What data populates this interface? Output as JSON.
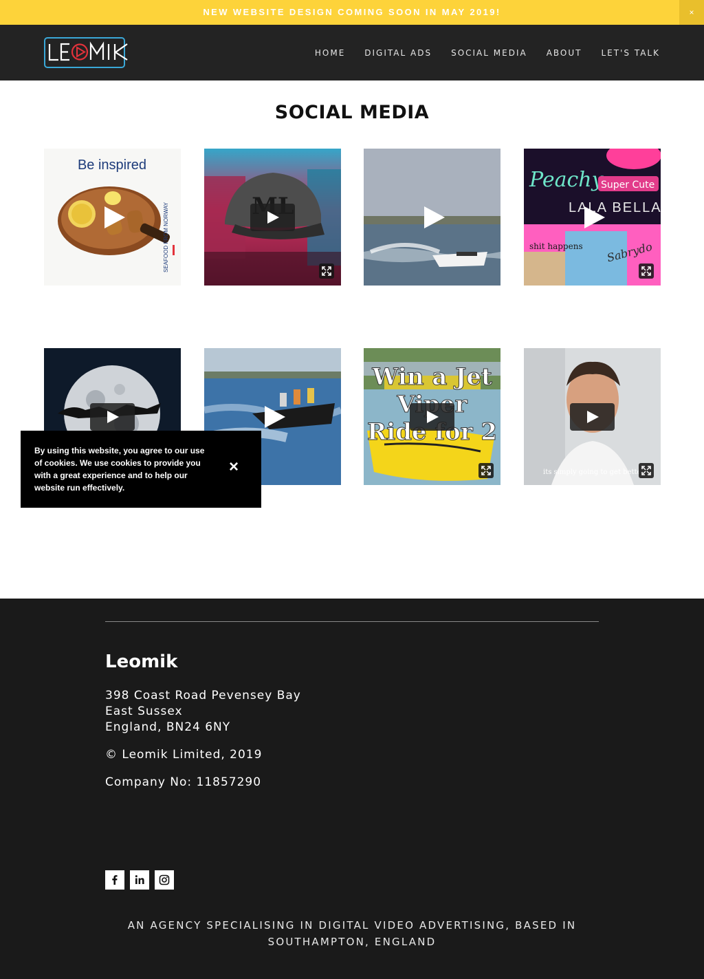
{
  "announcement": {
    "text": "NEW WEBSITE DESIGN COMING SOON IN MAY 2019!",
    "close_label": "×"
  },
  "header": {
    "logo_text": "LEOMIK",
    "nav": [
      "HOME",
      "DIGITAL ADS",
      "SOCIAL MEDIA",
      "ABOUT",
      "LET'S TALK"
    ]
  },
  "main": {
    "title": "SOCIAL MEDIA",
    "tiles": [
      {
        "caption": "Be inspired",
        "brand": "SEAFOOD FROM NORWAY"
      },
      {
        "caption": "ML"
      },
      {
        "caption": ""
      },
      {
        "caption": "Peachy",
        "caption2": "Super Cute",
        "caption3": "LALA BELLA",
        "caption4": "shit happens",
        "caption5": "Sabrydo"
      },
      {
        "caption": ""
      },
      {
        "caption": ""
      },
      {
        "caption": "Win a Jet Viper Ride for 2"
      },
      {
        "caption": "its simply going to get better"
      }
    ]
  },
  "cookie": {
    "text": "By using this website, you agree to our use of cookies. We use cookies to provide you with a great experience and to help our website run effectively.",
    "close_label": "×"
  },
  "footer": {
    "brand": "Leomik",
    "address_line1": "398 Coast Road Pevensey Bay",
    "address_line2": "East Sussex",
    "address_line3": "England, BN24 6NY",
    "copyright": "© Leomik Limited, 2019",
    "company_no": "Company No: 11857290",
    "social": [
      "facebook-icon",
      "linkedin-icon",
      "instagram-icon"
    ],
    "tagline": "AN AGENCY SPECIALISING IN DIGITAL VIDEO ADVERTISING, BASED IN SOUTHAMPTON, ENGLAND"
  },
  "colors": {
    "accent_yellow": "#fdd33a",
    "header_bg": "#232323",
    "footer_bg": "#1a1a1a",
    "logo_blue": "#3aa8d8",
    "logo_red": "#e3323b"
  }
}
